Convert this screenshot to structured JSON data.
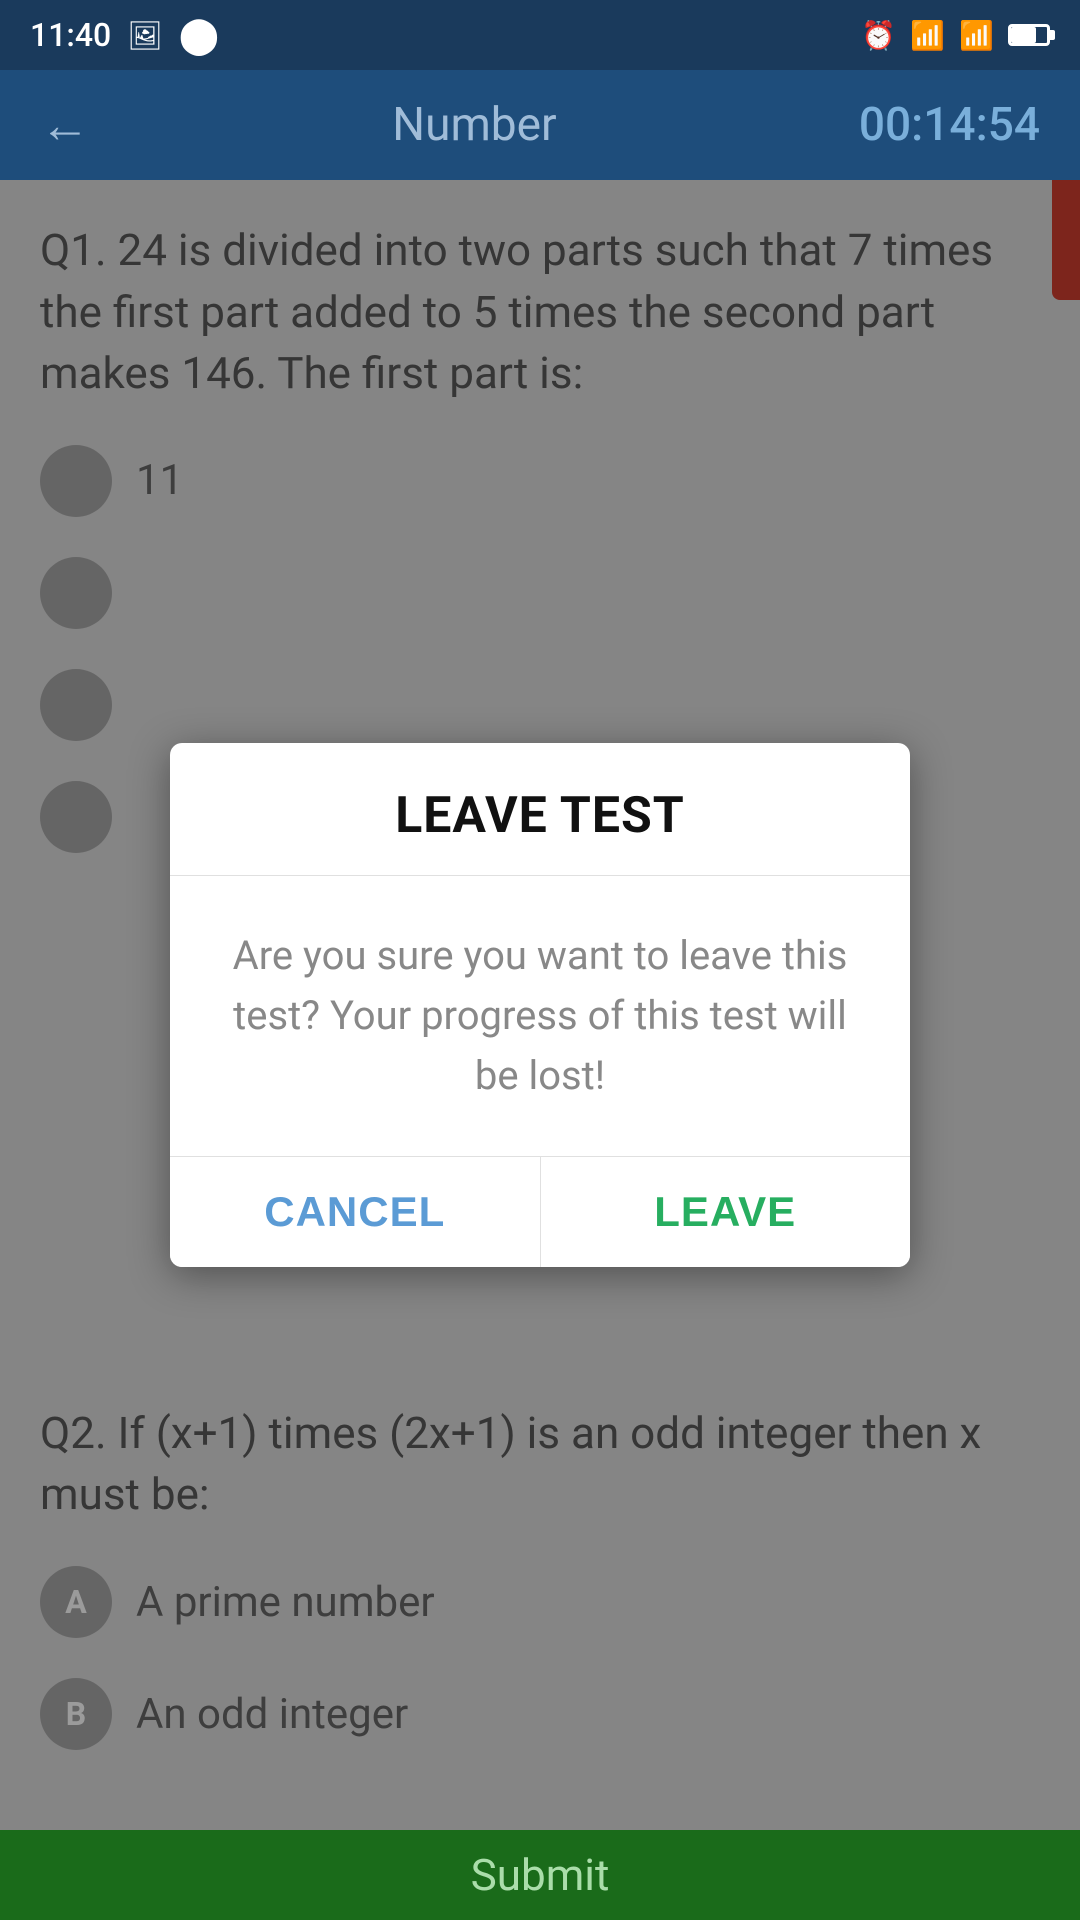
{
  "statusBar": {
    "time": "11:40"
  },
  "appBar": {
    "backLabel": "←",
    "title": "Number",
    "timer": "00:14:54"
  },
  "background": {
    "q1": {
      "text": "Q1. 24 is divided into two parts such that 7 times the first part added to 5 times the second part makes 146. The first part is:",
      "options": [
        {
          "label": "",
          "text": "11"
        },
        {
          "label": "",
          "text": ""
        },
        {
          "label": "",
          "text": ""
        },
        {
          "label": "",
          "text": ""
        }
      ]
    },
    "q2": {
      "text": "Q2. If (x+1) times (2x+1) is an odd integer then x must be:",
      "options": [
        {
          "label": "A",
          "text": "A prime number"
        },
        {
          "label": "B",
          "text": "An odd integer"
        }
      ]
    }
  },
  "dialog": {
    "title": "LEAVE TEST",
    "message": "Are you sure you want to leave this test? Your progress of this test will be lost!",
    "cancelLabel": "CANCEL",
    "leaveLabel": "LEAVE"
  },
  "submitBar": {
    "label": "Submit"
  }
}
